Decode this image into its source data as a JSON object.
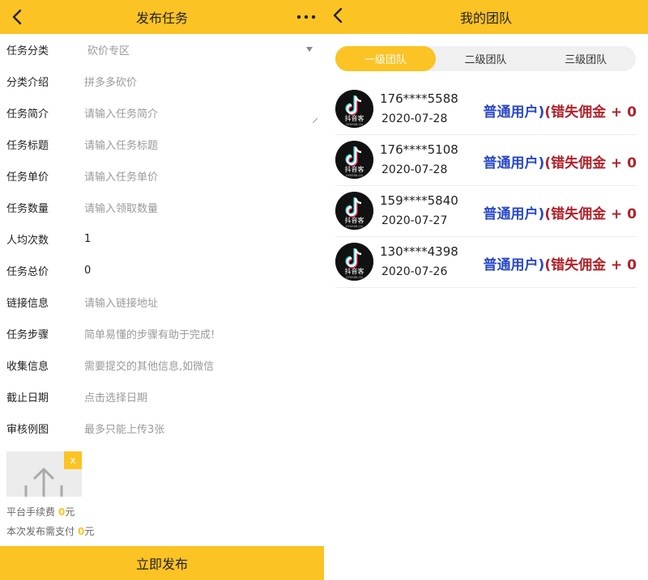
{
  "left": {
    "header": {
      "title": "发布任务"
    },
    "form": [
      {
        "label": "任务分类",
        "value": "砍价专区",
        "kind": "select"
      },
      {
        "label": "分类介绍",
        "value": "拼多多砍价",
        "kind": "text"
      },
      {
        "label": "任务简介",
        "value": "请输入任务简介",
        "kind": "textarea"
      },
      {
        "label": "任务标题",
        "value": "请输入任务标题",
        "kind": "input"
      },
      {
        "label": "任务单价",
        "value": "请输入任务单价",
        "kind": "input"
      },
      {
        "label": "任务数量",
        "value": "请输入领取数量",
        "kind": "input"
      },
      {
        "label": "人均次数",
        "value": "1",
        "kind": "input-filled"
      },
      {
        "label": "任务总价",
        "value": "0",
        "kind": "text-filled"
      },
      {
        "label": "链接信息",
        "value": "请输入链接地址",
        "kind": "input"
      },
      {
        "label": "任务步骤",
        "value": "简单易懂的步骤有助于完成!",
        "kind": "input"
      },
      {
        "label": "收集信息",
        "value": "需要提交的其他信息,如微信",
        "kind": "input"
      },
      {
        "label": "截止日期",
        "value": "点击选择日期",
        "kind": "input"
      },
      {
        "label": "审核例图",
        "value": "最多只能上传3张",
        "kind": "text"
      }
    ],
    "upload": {
      "remove_label": "x"
    },
    "fees": {
      "platform_label": "平台手续费",
      "platform_amount": "0",
      "platform_unit": "元",
      "pay_label": "本次发布需支付",
      "pay_amount": "0",
      "pay_unit": "元"
    },
    "submit_label": "立即发布"
  },
  "right": {
    "header": {
      "title": "我的团队"
    },
    "tabs": [
      {
        "label": "一级团队",
        "active": true
      },
      {
        "label": "二级团队",
        "active": false
      },
      {
        "label": "三级团队",
        "active": false
      }
    ],
    "members": [
      {
        "phone": "176****5588",
        "date": "2020-07-28",
        "role": "普通用户)",
        "miss": "(错失佣金 + 0"
      },
      {
        "phone": "176****5108",
        "date": "2020-07-28",
        "role": "普通用户)",
        "miss": "(错失佣金 + 0"
      },
      {
        "phone": "159****5840",
        "date": "2020-07-27",
        "role": "普通用户)",
        "miss": "(错失佣金 + 0"
      },
      {
        "phone": "130****4398",
        "date": "2020-07-26",
        "role": "普通用户)",
        "miss": "(错失佣金 + 0"
      }
    ],
    "avatar_text": "抖音客",
    "avatar_subtext": "DYKEBB.CN"
  },
  "colors": {
    "accent": "#fcc324",
    "role": "#2947c9",
    "miss": "#b0222a"
  }
}
